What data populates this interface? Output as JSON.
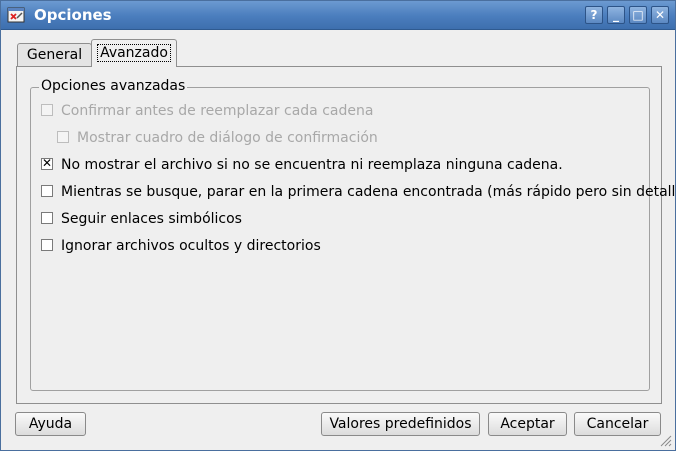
{
  "window": {
    "title": "Opciones",
    "help_label": "?",
    "minimize_label": "_",
    "maximize_label": "□",
    "close_label": "✕"
  },
  "tabs": [
    {
      "label": "General",
      "active": false
    },
    {
      "label": "Avanzado",
      "active": true
    }
  ],
  "group": {
    "title": "Opciones avanzadas",
    "options": [
      {
        "label": "Confirmar antes de reemplazar cada cadena",
        "checked": false,
        "enabled": false
      },
      {
        "label": "Mostrar cuadro de diálogo de confirmación",
        "checked": false,
        "enabled": false
      },
      {
        "label": "No mostrar el archivo si no se encuentra ni reemplaza ninguna cadena.",
        "checked": true,
        "enabled": true
      },
      {
        "label": "Mientras se busque, parar en la primera cadena encontrada (más rápido pero sin detalles)",
        "checked": false,
        "enabled": true
      },
      {
        "label": "Seguir enlaces simbólicos",
        "checked": false,
        "enabled": true
      },
      {
        "label": "Ignorar archivos ocultos y directorios",
        "checked": false,
        "enabled": true
      }
    ]
  },
  "buttons": {
    "help": "Ayuda",
    "defaults": "Valores predefinidos",
    "accept": "Aceptar",
    "cancel": "Cancelar"
  },
  "colors": {
    "titlebar": "#4a7dbd",
    "window_bg": "#efefef",
    "disabled_text": "#a8a8a8"
  }
}
